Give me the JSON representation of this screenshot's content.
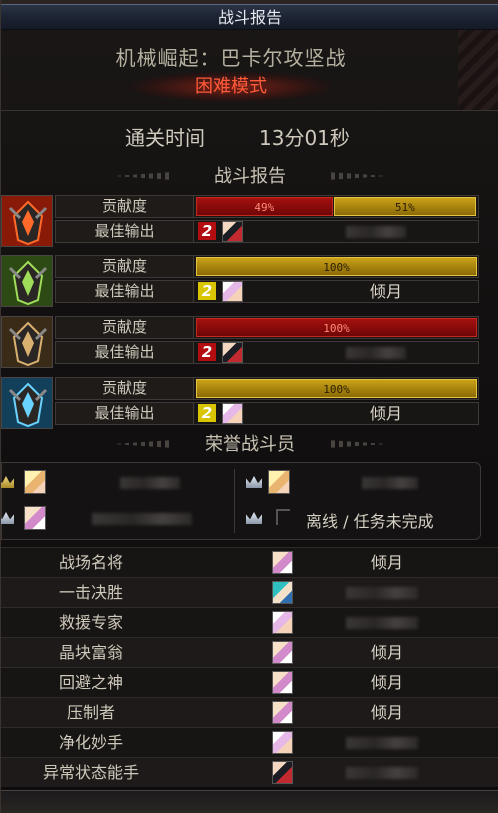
{
  "window": {
    "title": "战斗报告"
  },
  "dungeon": {
    "name": "机械崛起：巴卡尔攻坚战",
    "difficulty": "困难模式"
  },
  "clear_time": {
    "label": "通关时间",
    "value": "13分01秒"
  },
  "report_section": {
    "title": "战斗报告"
  },
  "bosses": [
    {
      "icon": "fire-dragon-boss-icon",
      "contribution_label": "贡献度",
      "best_output_label": "最佳输出",
      "contribution": [
        {
          "color": "red",
          "percent": 49,
          "text": "49%"
        },
        {
          "color": "gold",
          "percent": 51,
          "text": "51%"
        }
      ],
      "best_rank": "2",
      "best_rank_color": "red",
      "best_player": ""
    },
    {
      "icon": "earth-dragon-boss-icon",
      "contribution_label": "贡献度",
      "best_output_label": "最佳输出",
      "contribution": [
        {
          "color": "gold",
          "percent": 100,
          "text": "100%"
        }
      ],
      "best_rank": "2",
      "best_rank_color": "gold",
      "best_player": "倾月"
    },
    {
      "icon": "dark-dragon-boss-icon",
      "contribution_label": "贡献度",
      "best_output_label": "最佳输出",
      "contribution": [
        {
          "color": "red",
          "percent": 100,
          "text": "100%"
        }
      ],
      "best_rank": "2",
      "best_rank_color": "red",
      "best_player": ""
    },
    {
      "icon": "ice-dragon-boss-icon",
      "contribution_label": "贡献度",
      "best_output_label": "最佳输出",
      "contribution": [
        {
          "color": "gold",
          "percent": 100,
          "text": "100%"
        }
      ],
      "best_rank": "2",
      "best_rank_color": "gold",
      "best_player": "倾月"
    }
  ],
  "honor_section": {
    "title": "荣誉战斗员",
    "offline_text": "离线 / 任务未完成"
  },
  "awards": [
    {
      "title": "战场名将",
      "player": "倾月"
    },
    {
      "title": "一击决胜",
      "player": ""
    },
    {
      "title": "救援专家",
      "player": ""
    },
    {
      "title": "晶块富翁",
      "player": "倾月"
    },
    {
      "title": "回避之神",
      "player": "倾月"
    },
    {
      "title": "压制者",
      "player": "倾月"
    },
    {
      "title": "净化妙手",
      "player": ""
    },
    {
      "title": "异常状态能手",
      "player": ""
    }
  ],
  "colors": {
    "accent_red": "#ff5a3a",
    "bar_red": "#a5110f",
    "bar_gold": "#c9a118"
  }
}
